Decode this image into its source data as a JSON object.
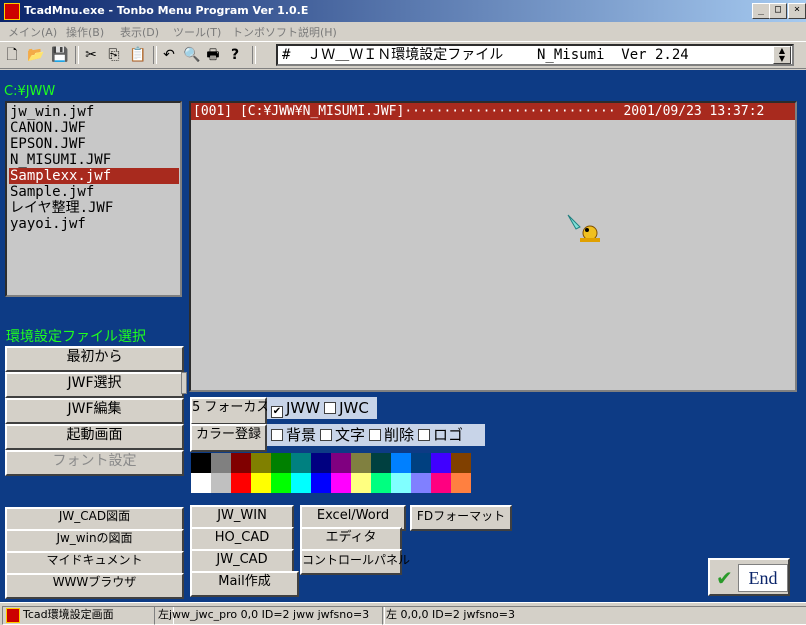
{
  "window": {
    "title": "TcadMnu.exe - Tonbo Menu Program Ver 1.0.E",
    "minimize": "_",
    "maximize": "□",
    "close": "×"
  },
  "menu": [
    "メイン(A)",
    "操作(B)",
    "表示(D)",
    "ツール(T)",
    "トンボソフト説明(H)"
  ],
  "toolbar": {
    "icons": [
      "new-icon",
      "open-icon",
      "save-icon",
      "cut-icon",
      "copy-icon",
      "paste-icon",
      "undo-icon",
      "find-icon",
      "print-icon",
      "help-icon"
    ],
    "info_text": "#  ＪＷ＿ＷＩＮ環境設定ファイル    N_Misumi  Ver 2.24",
    "spin": "▲\n▼"
  },
  "left": {
    "path": "C:¥JWW",
    "files": [
      "jw_win.jwf",
      "CANON.JWF",
      "EPSON.JWF",
      "N_MISUMI.JWF",
      "Samplexx.jwf",
      "Sample.jwf",
      "レイヤ整理.JWF",
      "yayoi.jwf"
    ],
    "selected_index": 4,
    "section_label": "環境設定ファイル選択",
    "buttons": [
      "最初から",
      "JWF選択",
      "JWF編集",
      "起動画面",
      "フォント設定"
    ]
  },
  "display": {
    "header": "[001] [C:¥JWW¥N_MISUMI.JWF]··························· 2001/09/23 13:37:2"
  },
  "controls": {
    "focus_button": "5 フォーカス",
    "color_button": "カラー登録",
    "jww_label": "JWW",
    "jwc_label": "JWC",
    "jww_checked": true,
    "jwc_checked": false,
    "check_labels": [
      "背景",
      "文字",
      "削除",
      "ロゴ"
    ]
  },
  "palette": {
    "row1": [
      "#000000",
      "#808080",
      "#800000",
      "#808000",
      "#008000",
      "#008080",
      "#000080",
      "#800080",
      "#808040",
      "#004040",
      "#0080ff",
      "#004080",
      "#4000ff",
      "#804000"
    ],
    "row2": [
      "#ffffff",
      "#c0c0c0",
      "#ff0000",
      "#ffff00",
      "#00ff00",
      "#00ffff",
      "#0000ff",
      "#ff00ff",
      "#ffff80",
      "#00ff80",
      "#80ffff",
      "#8080ff",
      "#ff0080",
      "#ff8040"
    ]
  },
  "bottom": {
    "left_buttons": [
      "JW_CAD図面",
      "Jw_winの図面",
      "マイドキュメント",
      "WWWブラウザ"
    ],
    "col2": [
      "JW_WIN",
      "HO_CAD",
      "JW_CAD",
      "Mail作成"
    ],
    "col3": [
      "Excel/Word",
      "エディタ",
      "コントロールパネル"
    ],
    "col4": [
      "FDフォーマット"
    ],
    "end_label": "End"
  },
  "status": {
    "p1": "Tcad環境設定画面",
    "p2": "左jww_jwc_pro 0,0 ID=2 jww jwfsno=3",
    "p3": "左 0,0,0 ID=2 jwfsno=3"
  }
}
